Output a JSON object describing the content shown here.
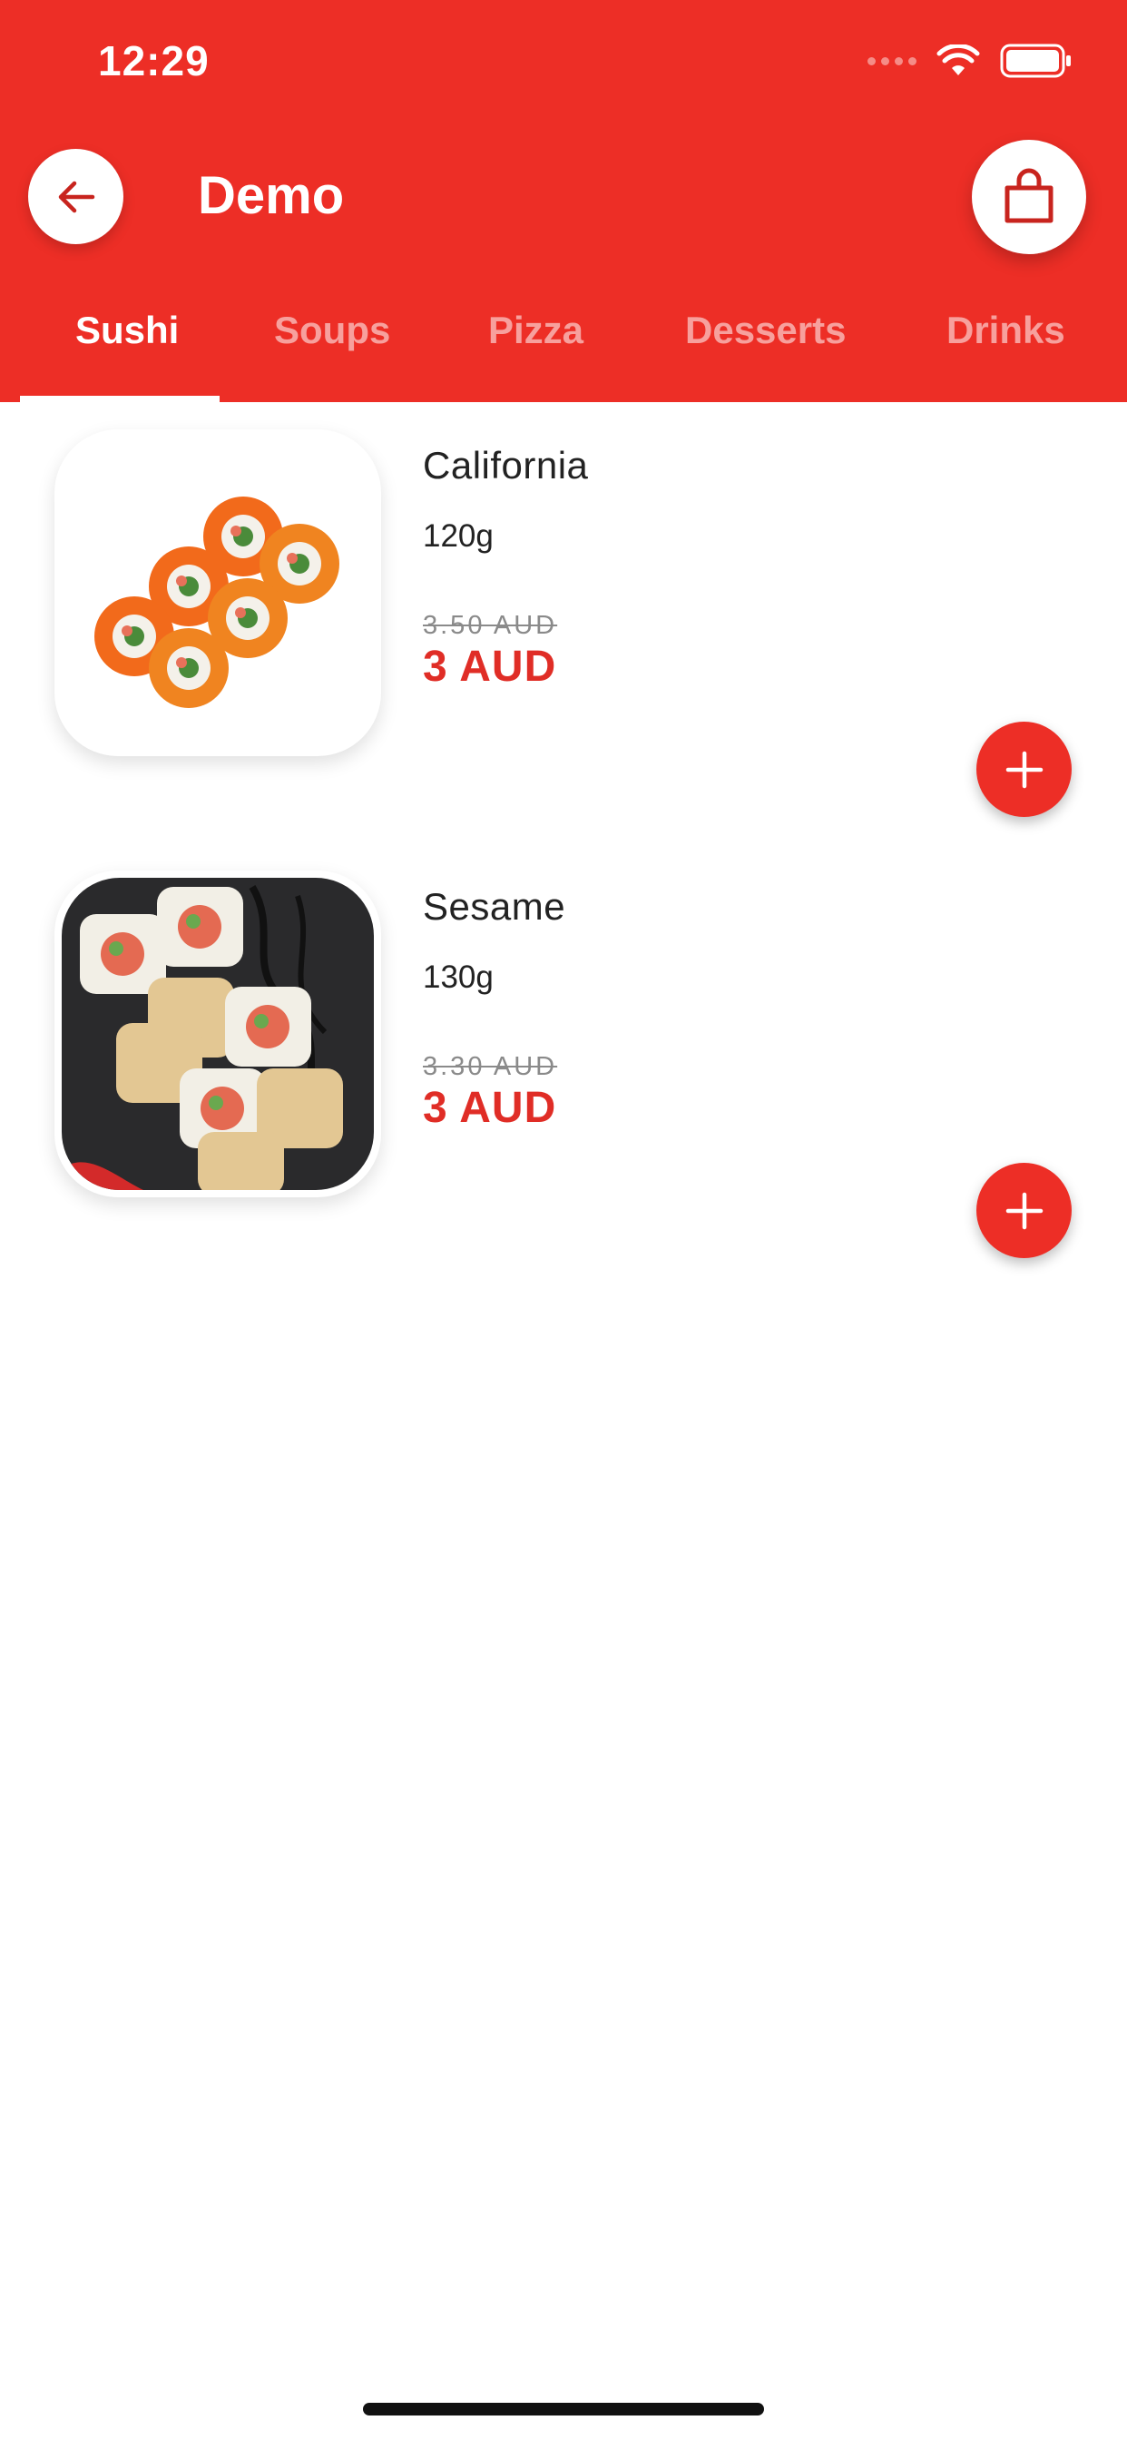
{
  "status_bar": {
    "time": "12:29"
  },
  "header": {
    "title": "Demo",
    "back_icon": "arrow-left-icon",
    "cart_icon": "shopping-bag-icon"
  },
  "tabs": [
    {
      "label": "Sushi",
      "active": true
    },
    {
      "label": "Soups",
      "active": false
    },
    {
      "label": "Pizza",
      "active": false
    },
    {
      "label": "Desserts",
      "active": false
    },
    {
      "label": "Drinks",
      "active": false
    }
  ],
  "products": [
    {
      "name": "California",
      "weight": "120g",
      "old_price": "3.50 AUD",
      "price": "3 AUD"
    },
    {
      "name": "Sesame",
      "weight": "130g",
      "old_price": "3.30 AUD",
      "price": "3 AUD"
    }
  ],
  "colors": {
    "brand": "#ed2e26",
    "price": "#e02d26",
    "old_price": "#8a8a8a"
  }
}
